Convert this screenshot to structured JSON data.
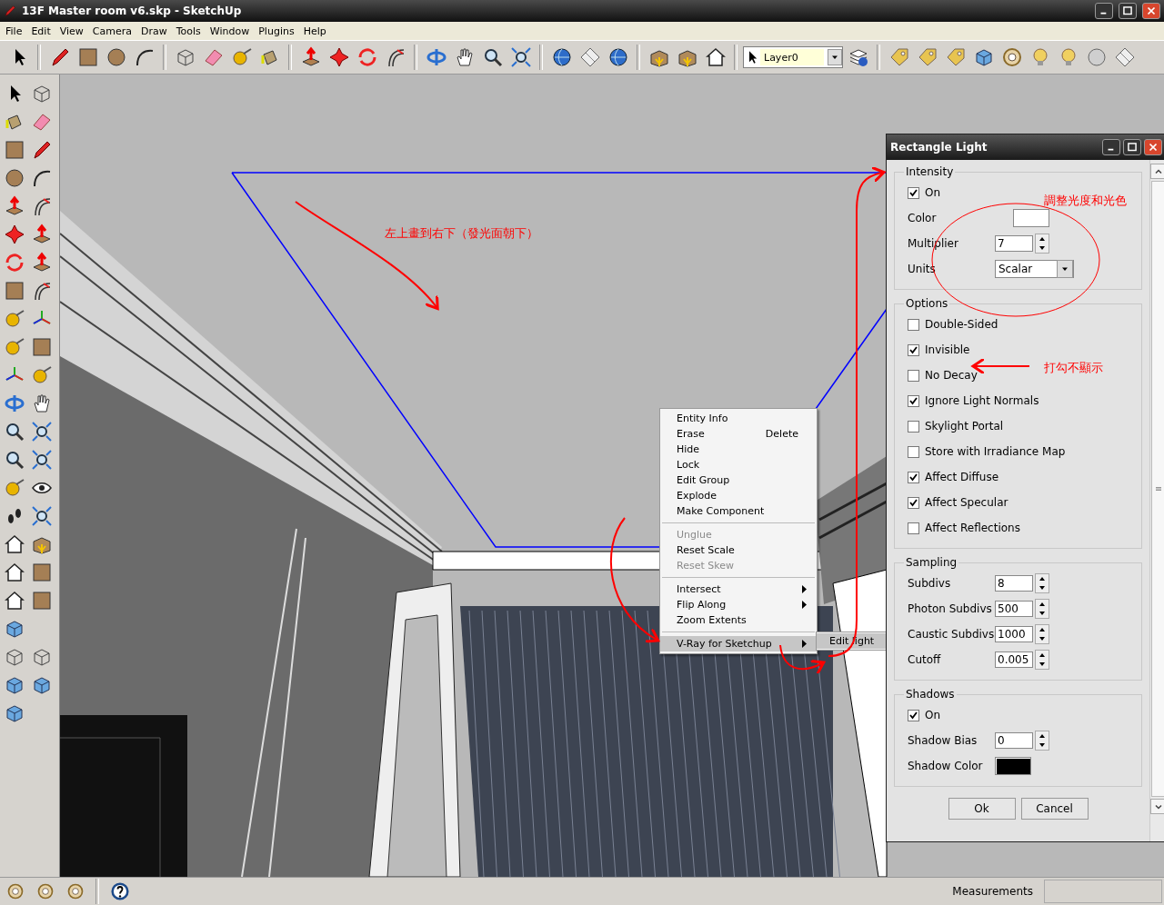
{
  "window": {
    "title": "13F Master room v6.skp - SketchUp"
  },
  "menu": [
    "File",
    "Edit",
    "View",
    "Camera",
    "Draw",
    "Tools",
    "Window",
    "Plugins",
    "Help"
  ],
  "layer_select": {
    "value": "Layer0"
  },
  "context_menu": {
    "groups": [
      [
        {
          "label": "Entity Info",
          "disabled": false,
          "submenu": false,
          "selected": false
        },
        {
          "label": "Erase",
          "shortcut": "Delete",
          "disabled": false,
          "submenu": false,
          "selected": false
        },
        {
          "label": "Hide",
          "disabled": false,
          "submenu": false,
          "selected": false
        },
        {
          "label": "Lock",
          "disabled": false,
          "submenu": false,
          "selected": false
        },
        {
          "label": "Edit Group",
          "disabled": false,
          "submenu": false,
          "selected": false
        },
        {
          "label": "Explode",
          "disabled": false,
          "submenu": false,
          "selected": false
        },
        {
          "label": "Make Component",
          "disabled": false,
          "submenu": false,
          "selected": false
        }
      ],
      [
        {
          "label": "Unglue",
          "disabled": true,
          "submenu": false,
          "selected": false
        },
        {
          "label": "Reset Scale",
          "disabled": false,
          "submenu": false,
          "selected": false
        },
        {
          "label": "Reset Skew",
          "disabled": true,
          "submenu": false,
          "selected": false
        }
      ],
      [
        {
          "label": "Intersect",
          "disabled": false,
          "submenu": true,
          "selected": false
        },
        {
          "label": "Flip Along",
          "disabled": false,
          "submenu": true,
          "selected": false
        },
        {
          "label": "Zoom Extents",
          "disabled": false,
          "submenu": false,
          "selected": false
        }
      ],
      [
        {
          "label": "V-Ray for Sketchup",
          "disabled": false,
          "submenu": true,
          "selected": true
        }
      ]
    ],
    "submenu": [
      {
        "label": "Edit light",
        "selected": true
      }
    ]
  },
  "annotations": [
    {
      "text": "左上畫到右下（發光面朝下）"
    },
    {
      "text": "調整光度和光色"
    },
    {
      "text": "打勾不顯示"
    }
  ],
  "dialog": {
    "title": "Rectangle Light",
    "sections": [
      {
        "title": "Intensity",
        "rows": [
          {
            "kind": "checkbox",
            "label": "On",
            "checked": true
          },
          {
            "kind": "color",
            "label": "Color",
            "color": "#ffffff"
          },
          {
            "kind": "spinner",
            "label": "Multiplier",
            "value": "7"
          },
          {
            "kind": "select",
            "label": "Units",
            "value": "Scalar"
          }
        ]
      },
      {
        "title": "Options",
        "rows": [
          {
            "kind": "checkbox",
            "label": "Double-Sided",
            "checked": false
          },
          {
            "kind": "checkbox",
            "label": "Invisible",
            "checked": true
          },
          {
            "kind": "checkbox",
            "label": "No Decay",
            "checked": false
          },
          {
            "kind": "checkbox",
            "label": "Ignore Light Normals",
            "checked": true
          },
          {
            "kind": "checkbox",
            "label": "Skylight Portal",
            "checked": false
          },
          {
            "kind": "checkbox",
            "label": "Store with Irradiance Map",
            "checked": false
          },
          {
            "kind": "checkbox",
            "label": "Affect Diffuse",
            "checked": true
          },
          {
            "kind": "checkbox",
            "label": "Affect Specular",
            "checked": true
          },
          {
            "kind": "checkbox",
            "label": "Affect Reflections",
            "checked": false
          }
        ]
      },
      {
        "title": "Sampling",
        "rows": [
          {
            "kind": "spinner",
            "label": "Subdivs",
            "value": "8"
          },
          {
            "kind": "spinner",
            "label": "Photon Subdivs",
            "value": "500"
          },
          {
            "kind": "spinner",
            "label": "Caustic Subdivs",
            "value": "1000"
          },
          {
            "kind": "spinner",
            "label": "Cutoff",
            "value": "0.005"
          }
        ]
      },
      {
        "title": "Shadows",
        "rows": [
          {
            "kind": "checkbox",
            "label": "On",
            "checked": true
          },
          {
            "kind": "spinner",
            "label": "Shadow Bias",
            "value": "0"
          },
          {
            "kind": "color",
            "label": "Shadow Color",
            "color": "#000000"
          }
        ]
      }
    ],
    "buttons": [
      "Ok",
      "Cancel"
    ]
  },
  "status_bar": {
    "label": "Measurements"
  }
}
